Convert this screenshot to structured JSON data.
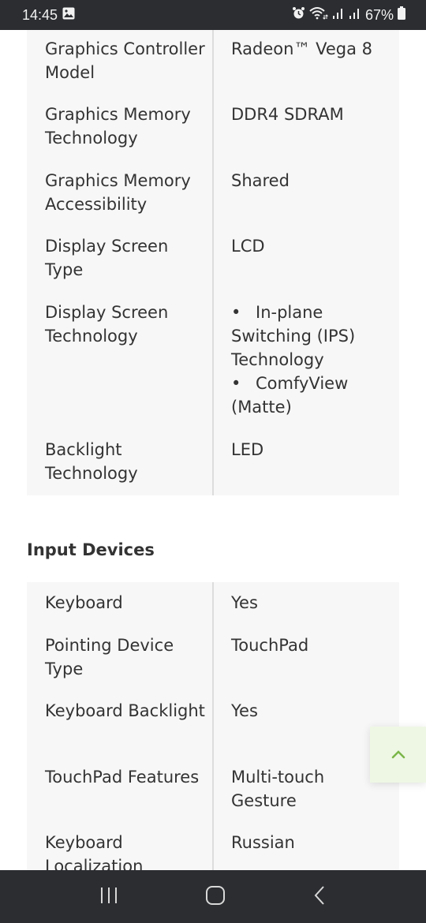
{
  "status_bar": {
    "time": "14:45",
    "battery_percent": "67%",
    "icons": [
      "gallery-icon",
      "alarm-icon",
      "wifi-icon",
      "signal-icon",
      "signal-icon",
      "battery-icon"
    ]
  },
  "display_table": {
    "rows": [
      {
        "label": "Graphics Controller Model",
        "value": "Radeon™ Vega 8"
      },
      {
        "label": "Graphics Memory Technology",
        "value": "DDR4 SDRAM"
      },
      {
        "label": "Graphics Memory Accessibility",
        "value": "Shared"
      },
      {
        "label": "Display Screen Type",
        "value": "LCD"
      },
      {
        "label": "Display Screen Technology",
        "values": [
          "In-plane Switching (IPS) Technology",
          "ComfyView (Matte)"
        ]
      },
      {
        "label": "Backlight Technology",
        "value": "LED"
      }
    ]
  },
  "input_devices": {
    "title": "Input Devices",
    "rows": [
      {
        "label": "Keyboard",
        "value": "Yes"
      },
      {
        "label": "Pointing Device Type",
        "value": "TouchPad"
      },
      {
        "label": "Keyboard Backlight",
        "value": "Yes"
      },
      {
        "label": "TouchPad Features",
        "value": "Multi-touch Gesture"
      },
      {
        "label": "Keyboard Localization",
        "value": "Russian"
      }
    ]
  },
  "scroll_top_button": {
    "icon": "chevron-up-icon",
    "color": "#7ab648"
  },
  "nav_bar": {
    "buttons": [
      "recent-apps",
      "home",
      "back"
    ]
  }
}
